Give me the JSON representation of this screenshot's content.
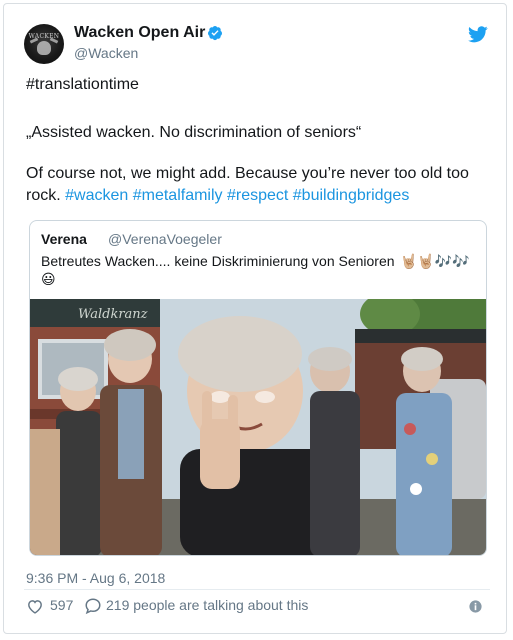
{
  "account": {
    "name": "Wacken Open Air",
    "handle": "@Wacken",
    "avatar_logo_text": "WACKEN",
    "verified_icon": "verified-badge-icon",
    "platform_icon": "twitter-bird-icon"
  },
  "tweet": {
    "hashtag_line": "#translationtime",
    "quote_line": "„Assisted wacken. No discrimination of seniors“",
    "body_line1": "Of course not, we might add. Because you’re never too old too",
    "body_line2_text": "rock. ",
    "body_line2_hashtags": "#wacken #metalfamily #respect #buildingbridges"
  },
  "quoted_tweet": {
    "name": "Verena",
    "handle": "@VerenaVoegeler",
    "text": "Betreutes Wacken.... keine Diskriminierung von Senioren",
    "emoji_line1": "🤘🏼🤘🏼🎶🎶",
    "emoji_line2": "😃",
    "photo_sign_text": "Waldkranz"
  },
  "meta": {
    "timestamp": "9:36 PM - Aug 6, 2018",
    "likes": "597",
    "talking": "219 people are talking about this"
  },
  "colors": {
    "link": "#1b95e0",
    "verified": "#1da1f2",
    "secondary_text": "#657786"
  }
}
